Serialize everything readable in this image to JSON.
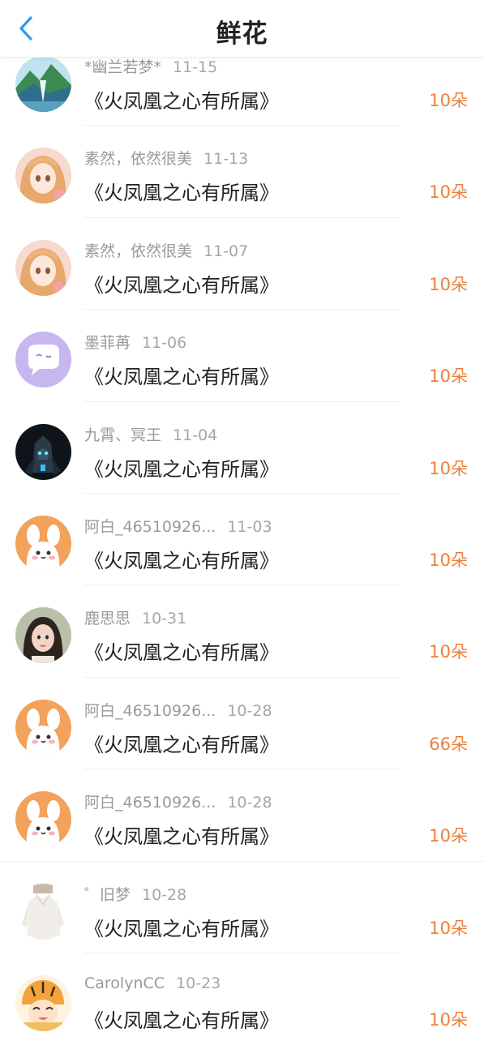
{
  "header": {
    "title": "鲜花"
  },
  "rows": [
    {
      "name": "*幽兰若梦*",
      "date": "11-15",
      "book": "《火凤凰之心有所属》",
      "count": "10朵",
      "avatar": "landscape-avatar"
    },
    {
      "name": "素然，依然很美",
      "date": "11-13",
      "book": "《火凤凰之心有所属》",
      "count": "10朵",
      "avatar": "anime-girl-avatar"
    },
    {
      "name": "素然，依然很美",
      "date": "11-07",
      "book": "《火凤凰之心有所属》",
      "count": "10朵",
      "avatar": "anime-girl-avatar"
    },
    {
      "name": "墨菲苒",
      "date": "11-06",
      "book": "《火凤凰之心有所属》",
      "count": "10朵",
      "avatar": "chat-bubble-avatar"
    },
    {
      "name": "九霄、冥王",
      "date": "11-04",
      "book": "《火凤凰之心有所属》",
      "count": "10朵",
      "avatar": "mecha-avatar"
    },
    {
      "name": "阿白_46510926...",
      "date": "11-03",
      "book": "《火凤凰之心有所属》",
      "count": "10朵",
      "avatar": "bunny-avatar"
    },
    {
      "name": "鹿思思",
      "date": "10-31",
      "book": "《火凤凰之心有所属》",
      "count": "10朵",
      "avatar": "photo-girl-avatar"
    },
    {
      "name": "阿白_46510926...",
      "date": "10-28",
      "book": "《火凤凰之心有所属》",
      "count": "66朵",
      "avatar": "bunny-avatar"
    },
    {
      "name": "阿白_46510926...",
      "date": "10-28",
      "book": "《火凤凰之心有所属》",
      "count": "10朵",
      "avatar": "bunny-avatar"
    },
    {
      "name": "゜旧梦",
      "date": "10-28",
      "book": "《火凤凰之心有所属》",
      "count": "10朵",
      "avatar": "white-shirt-avatar"
    },
    {
      "name": "CarolynCC",
      "date": "10-23",
      "book": "《火凤凰之心有所属》",
      "count": "10朵",
      "avatar": "tiger-hat-avatar"
    }
  ],
  "colors": {
    "accent": "#ee7f3c",
    "back": "#2d9bf0"
  }
}
